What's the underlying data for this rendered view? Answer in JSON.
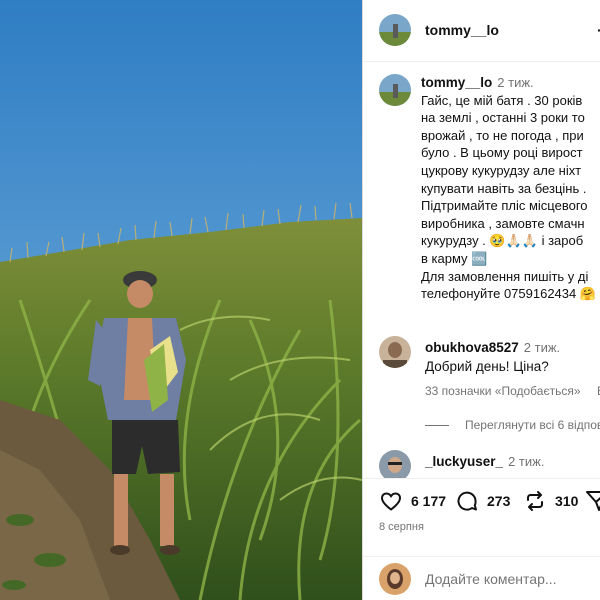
{
  "photo": {
    "alt_icon": "post-photo-cornfield"
  },
  "header": {
    "username": "tommy__lo",
    "more": "·"
  },
  "caption": {
    "username": "tommy__lo",
    "time": "2 тиж.",
    "lines": [
      "Гайс, це мій батя . 30 років",
      "на землі , останні 3 роки то",
      "врожай , то не погода , при",
      "було . В цьому році вирост",
      "цукрову кукурудзу  але ніхт",
      "купувати навіть за безцінь .",
      "Підтримайте пліс місцевого",
      "виробника , замовте смачн",
      "кукурудзу . 🥹🙏🏻🙏🏻 і зароб",
      "в карму 🆒",
      "Для замовлення пишіть у ді",
      "телефонуйте 0759162434 🤗"
    ]
  },
  "comments": [
    {
      "username": "obukhova8527",
      "time": "2 тиж.",
      "text": "Добрий день! Ціна?",
      "likes": "33 позначки «Подобається»",
      "reply": "В"
    },
    {
      "username": "_luckyuser_",
      "time": "2 тиж."
    }
  ],
  "view_replies": "Переглянути всі 6 відпов",
  "actions": {
    "likes": "6 177",
    "comments": "273",
    "shares": "310"
  },
  "date": "8 серпня",
  "add_comment": {
    "placeholder": "Додайте коментар..."
  },
  "colors": {
    "secondary_text": "#737373",
    "divider": "#efefef",
    "sky": "#3d86c6"
  }
}
